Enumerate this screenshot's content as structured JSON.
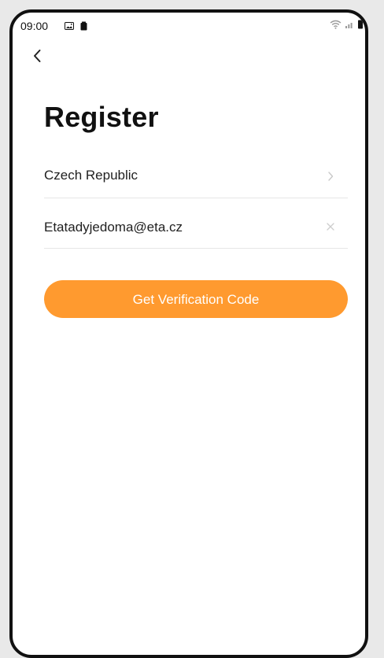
{
  "status_bar": {
    "time": "09:00",
    "icons_left": [
      "image-icon",
      "battery-saver-icon"
    ],
    "icons_right": [
      "wifi-icon",
      "signal-icon",
      "battery-icon"
    ]
  },
  "header": {
    "back_icon": "chevron-left-icon",
    "title": "Register"
  },
  "form": {
    "country_value": "Czech Republic",
    "email_value": "Etatadyjedoma@eta.cz",
    "country_icon": "chevron-right-icon",
    "clear_icon": "close-icon"
  },
  "actions": {
    "verification_button_label": "Get Verification Code"
  },
  "colors": {
    "accent": "#ff9a2f",
    "text": "#1f1f1f",
    "divider": "#e6e6e6"
  }
}
